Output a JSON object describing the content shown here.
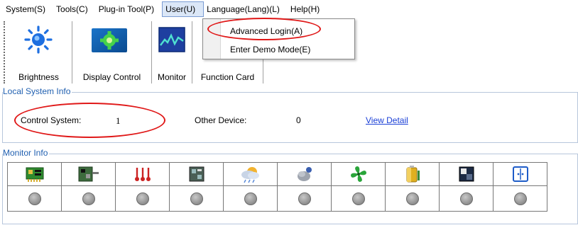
{
  "menubar": {
    "items": [
      {
        "label": "System(S)"
      },
      {
        "label": "Tools(C)"
      },
      {
        "label": "Plug-in Tool(P)"
      },
      {
        "label": "User(U)"
      },
      {
        "label": "Language(Lang)(L)"
      },
      {
        "label": "Help(H)"
      }
    ]
  },
  "user_menu": {
    "items": [
      {
        "label": "Advanced Login(A)"
      },
      {
        "label": "Enter Demo Mode(E)"
      }
    ]
  },
  "toolbar": {
    "items": [
      {
        "label": "Brightness",
        "icon": "brightness-sun-icon"
      },
      {
        "label": "Display Control",
        "icon": "display-control-gear-icon"
      },
      {
        "label": "Monitor",
        "icon": "monitor-wave-icon"
      },
      {
        "label": "Function Card",
        "icon": ""
      }
    ]
  },
  "local_system_info": {
    "title": "Local System Info",
    "control_system_label": "Control System:",
    "control_system_value": "1",
    "other_device_label": "Other Device:",
    "other_device_value": "0",
    "view_detail_link": "View Detail"
  },
  "monitor_info": {
    "title": "Monitor Info",
    "icons": [
      "receiving-card-icon",
      "sending-card-icon",
      "temperature-icon",
      "module-icon",
      "weather-humidity-icon",
      "smoke-icon",
      "fan-icon",
      "power-battery-icon",
      "cabinet-door-icon",
      "panel-icon"
    ]
  },
  "colors": {
    "accent": "#1f5fb0",
    "annotation": "#e01818",
    "link": "#1a3fd6"
  }
}
